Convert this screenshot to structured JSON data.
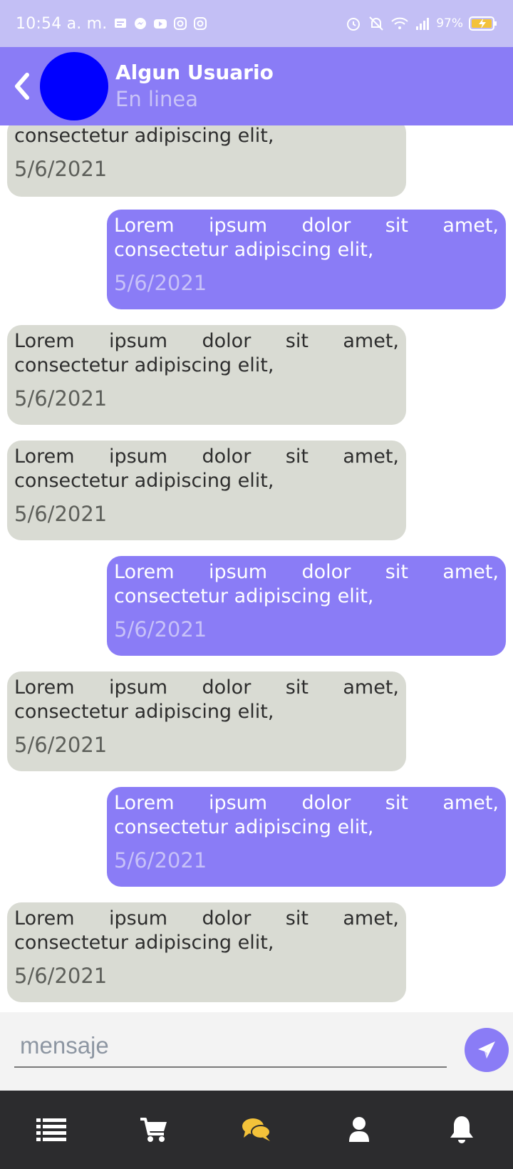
{
  "status_bar": {
    "time": "10:54 a. m.",
    "battery": "97%",
    "left_icons": [
      "message-icon",
      "messenger-icon",
      "youtube-icon",
      "instagram-icon",
      "instagram-icon"
    ],
    "right_icons": [
      "alarm-icon",
      "mute-icon",
      "wifi-icon",
      "signal-icon",
      "battery-charging-icon"
    ],
    "background": "#c3bff5"
  },
  "header": {
    "user_name": "Algun Usuario",
    "user_status": "En linea",
    "avatar_color": "#0000ff",
    "background": "#8a7cf6",
    "back_icon": "chevron-left-icon"
  },
  "messages": [
    {
      "side": "recv",
      "text": "consectetur adipiscing elit,",
      "date": "5/6/2021"
    },
    {
      "side": "sent",
      "text": "Lorem ipsum dolor sit amet, consectetur adipiscing elit,",
      "date": "5/6/2021"
    },
    {
      "side": "recv",
      "text": "Lorem ipsum dolor sit amet, consectetur adipiscing elit,",
      "date": "5/6/2021"
    },
    {
      "side": "recv",
      "text": "Lorem ipsum dolor sit amet, consectetur adipiscing elit,",
      "date": "5/6/2021"
    },
    {
      "side": "sent",
      "text": "Lorem ipsum dolor sit amet, consectetur adipiscing elit,",
      "date": "5/6/2021"
    },
    {
      "side": "recv",
      "text": "Lorem ipsum dolor sit amet, consectetur adipiscing elit,",
      "date": "5/6/2021"
    },
    {
      "side": "sent",
      "text": "Lorem ipsum dolor sit amet, consectetur adipiscing elit,",
      "date": "5/6/2021"
    },
    {
      "side": "recv",
      "text": "Lorem ipsum dolor sit amet, consectetur adipiscing elit,",
      "date": "5/6/2021"
    }
  ],
  "input": {
    "placeholder": "mensaje",
    "value": "",
    "send_icon": "paper-plane-icon"
  },
  "bottom_nav": {
    "items": [
      {
        "icon": "list-icon",
        "active": false
      },
      {
        "icon": "cart-icon",
        "active": false
      },
      {
        "icon": "chat-icon",
        "active": true
      },
      {
        "icon": "user-icon",
        "active": false
      },
      {
        "icon": "bell-icon",
        "active": false
      }
    ],
    "active_color": "#f3c23a",
    "inactive_color": "#ffffff",
    "background": "#2c2c2e"
  },
  "colors": {
    "sent_bubble": "#8a7cf6",
    "received_bubble": "#d9dbd3"
  }
}
